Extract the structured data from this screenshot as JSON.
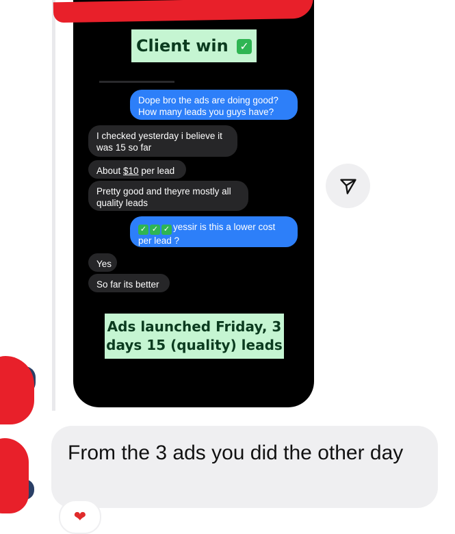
{
  "screenshot": {
    "header_sticker": {
      "text": "Client win",
      "badge": "✓"
    },
    "messages": [
      {
        "side": "sent",
        "text": "Dope bro the ads are doing good? How many leads you guys have?"
      },
      {
        "side": "received",
        "text": "I checked yesterday i believe it was 15 so far"
      },
      {
        "side": "received",
        "prefix": "About ",
        "link_text": "$10",
        "suffix": " per lead"
      },
      {
        "side": "received",
        "text": "Pretty good and theyre mostly all quality leads"
      },
      {
        "side": "sent",
        "checks": [
          "✓",
          "✓",
          "✓"
        ],
        "text": "yessir is this a lower cost per lead ?"
      },
      {
        "side": "received",
        "text": "Yes"
      },
      {
        "side": "received",
        "text": "So far its better"
      }
    ],
    "footer_sticker": {
      "text": "Ads launched Friday, 3 days 15 (quality) leads"
    }
  },
  "reply": {
    "text": "From the 3 ads you did the other day"
  },
  "reaction": {
    "emoji": "❤"
  },
  "colors": {
    "sent_bubble": "#2d7ff9",
    "received_bubble": "#262628",
    "sticker": "#c5f5d2",
    "reply_bg": "#efeff1",
    "redaction": "#e8202a"
  },
  "icons": {
    "share": "send-icon"
  }
}
